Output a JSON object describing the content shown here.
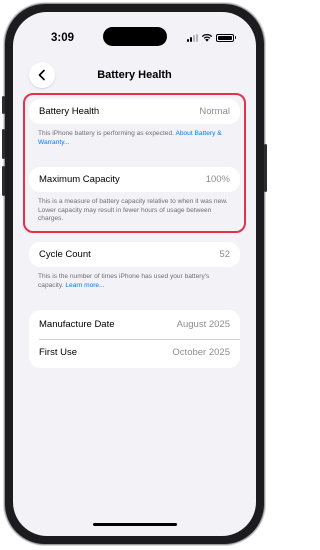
{
  "status_bar": {
    "time": "3:09"
  },
  "nav": {
    "title": "Battery Health"
  },
  "battery_health": {
    "label": "Battery Health",
    "value": "Normal",
    "footnote_text": "This iPhone battery is performing as expected. ",
    "footnote_link": "About Battery & Warranty..."
  },
  "maximum_capacity": {
    "label": "Maximum Capacity",
    "value": "100%",
    "footnote_text": "This is a measure of battery capacity relative to when it was new. Lower capacity may result in fewer hours of usage between charges."
  },
  "cycle_count": {
    "label": "Cycle Count",
    "value": "52",
    "footnote_text": "This is the number of times iPhone has used your battery's capacity. ",
    "footnote_link": "Learn more..."
  },
  "dates": [
    {
      "label": "Manufacture Date",
      "value": "August 2025"
    },
    {
      "label": "First Use",
      "value": "October 2025"
    }
  ],
  "colors": {
    "highlight": "#e8304a",
    "link": "#007aff",
    "background": "#f2f2f7"
  }
}
